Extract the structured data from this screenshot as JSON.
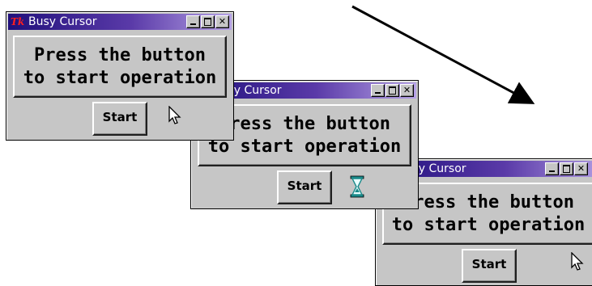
{
  "windows": [
    {
      "title": "Busy Cursor",
      "button_line1": "Press the button",
      "button_line2": "to start operation",
      "start_label": "Start",
      "cursor": "arrow-pointer-icon"
    },
    {
      "title": "Busy Cursor",
      "button_line1": "Press the button",
      "button_line2": "to start operation",
      "start_label": "Start",
      "cursor": "hourglass-icon"
    },
    {
      "title": "Busy Cursor",
      "button_line1": "Press the button",
      "button_line2": "to start operation",
      "start_label": "Start",
      "cursor": "arrow-pointer-icon"
    }
  ],
  "icons": {
    "app_icon": "tk-logo-icon",
    "app_icon_text": "Tk",
    "minimize": "minimize-icon",
    "maximize": "maximize-icon",
    "close": "close-icon",
    "close_glyph": "✕"
  },
  "colors": {
    "title_start": "#20107c",
    "title_end": "#b6a2e6",
    "window_bg": "#c6c6c6",
    "hourglass": "#1a8a8a",
    "tk_logo": "#ff1f1f"
  }
}
